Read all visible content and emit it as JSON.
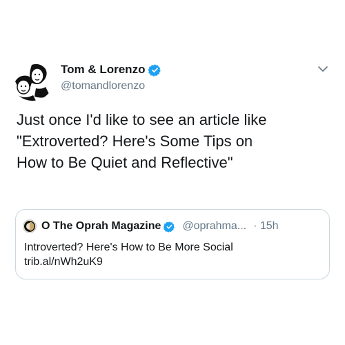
{
  "tweet": {
    "display_name": "Tom & Lorenzo",
    "handle": "@tomandlorenzo",
    "text": "Just once I'd like to see an article like\n\"Extroverted? Here's Some Tips on\nHow to Be Quiet and Reflective\"",
    "avatar_icon": "cartoon-avatar-icon",
    "verified_icon": "verified-badge-icon",
    "menu_icon": "chevron-down-icon"
  },
  "quote": {
    "display_name": "O The Oprah Magazine",
    "handle": "@oprahma...",
    "time": "· 15h",
    "text": "Introverted? Here's How to Be More Social",
    "link": "trib.al/nWh2uK9",
    "avatar_icon": "oprah-magazine-logo-icon",
    "verified_icon": "verified-badge-icon"
  },
  "colors": {
    "verified": "#1da1f2",
    "secondary_text": "#657786",
    "border": "#ccd6dd"
  }
}
